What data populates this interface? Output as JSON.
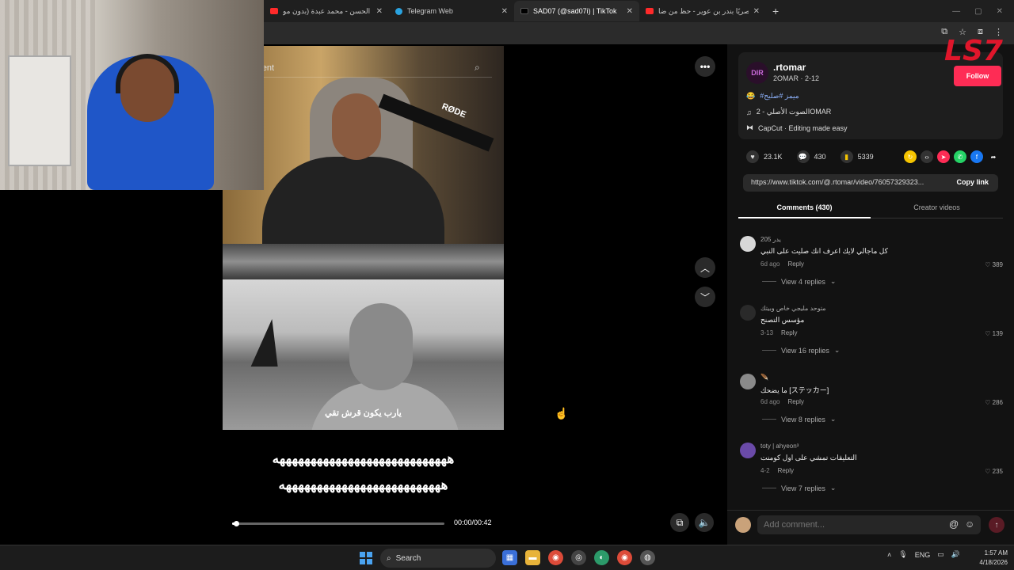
{
  "browser": {
    "tabs": [
      {
        "title": "بنة الحسن - محمد عبدة (بدون مو",
        "icon": "youtube-icon",
        "color": "#ff2a2a",
        "active": false
      },
      {
        "title": "Telegram Web",
        "icon": "telegram-icon",
        "color": "#2aa3e0",
        "active": false
      },
      {
        "title": "SAD07 (@sad07i) | TikTok",
        "icon": "tiktok-icon",
        "color": "#111111",
        "active": true
      },
      {
        "title": "حصريًا بندر بن عوير - حظ من ضا",
        "icon": "youtube-icon",
        "color": "#ff2a2a",
        "active": false
      }
    ],
    "new_tab": "+"
  },
  "video": {
    "related_label": "elated content",
    "caption": "يارب يكون قرش تقي",
    "bigtext_line1": "ههههههههههههههههههههههههههههه",
    "bigtext_line2": "ههههههههههههههههههههههههههه",
    "timecode": "00:00/00:42",
    "progress": 0.02
  },
  "post": {
    "author": ".rtomar",
    "author_sub": "2OMAR · 2-12",
    "avatar_text": "DIR",
    "follow_label": "Follow",
    "hashtags": "#ميمز #صليح",
    "sound": "الصوت الأصلي - 2OMAR",
    "capcut": "CapCut · Editing made easy",
    "likes": "23.1K",
    "comments": "430",
    "saves": "5339",
    "url": "https://www.tiktok.com/@.rtomar/video/76057329323...",
    "copy_label": "Copy link",
    "tab_comments": "Comments (430)",
    "tab_creator": "Creator videos"
  },
  "comments": [
    {
      "user": "205 يدر",
      "text": "كل ماجالي لايك اعرف انك صليت على النبي",
      "time": "6d ago",
      "reply": "Reply",
      "likes": "389",
      "replies": "View 4 replies",
      "avatar_color": "#d8d8d8"
    },
    {
      "user": "متوحد مليجي خاص وبيتك",
      "text": "مؤسس التصنح",
      "time": "3-13",
      "reply": "Reply",
      "likes": "139",
      "replies": "View 16 replies",
      "avatar_color": "#2a2a2a"
    },
    {
      "user": "🪶",
      "text": "ما يضحك [ステッカー]",
      "time": "6d ago",
      "reply": "Reply",
      "likes": "286",
      "replies": "View 8 replies",
      "avatar_color": "#8a8a8a"
    },
    {
      "user": "toty | ahyeon³",
      "text": "التعليقات تمشي على اول كومنت",
      "time": "4-2",
      "reply": "Reply",
      "likes": "235",
      "replies": "View 7 replies",
      "avatar_color": "#6a4aa8"
    }
  ],
  "add_comment": {
    "placeholder": "Add comment..."
  },
  "logo": "LS7",
  "taskbar": {
    "search": "Search",
    "lang": "ENG",
    "time": "1:57 AM",
    "date": "4/18/2026"
  }
}
